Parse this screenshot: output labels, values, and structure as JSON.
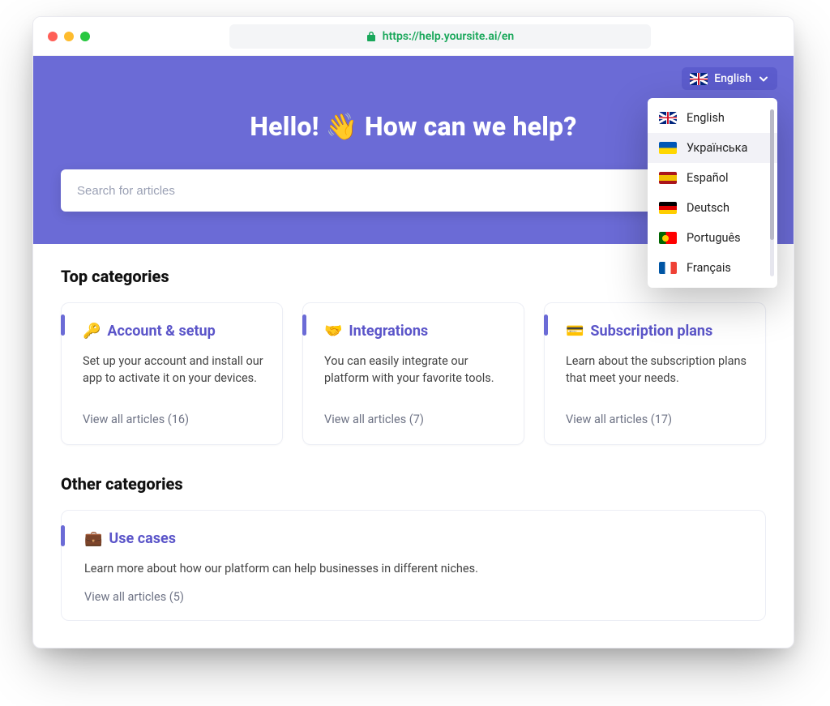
{
  "browser": {
    "url": "https://help.yoursite.ai/en"
  },
  "language_selector": {
    "current": {
      "label": "English",
      "flag": "uk"
    },
    "options": [
      {
        "label": "English",
        "flag": "uk"
      },
      {
        "label": "Українська",
        "flag": "ua"
      },
      {
        "label": "Español",
        "flag": "es"
      },
      {
        "label": "Deutsch",
        "flag": "de"
      },
      {
        "label": "Português",
        "flag": "pt"
      },
      {
        "label": "Français",
        "flag": "fr"
      }
    ],
    "hover_index": 1
  },
  "hero": {
    "title": "Hello! 👋 How can we help?",
    "search_placeholder": "Search for articles"
  },
  "sections": {
    "top": {
      "heading": "Top categories",
      "cards": [
        {
          "emoji": "🔑",
          "title": "Account & setup",
          "desc": "Set up your account and install our app to activate it on your devices.",
          "link": "View all articles (16)"
        },
        {
          "emoji": "🤝",
          "title": "Integrations",
          "desc": "You can easily integrate our platform with your favorite tools.",
          "link": "View all articles (7)"
        },
        {
          "emoji": "💳",
          "title": "Subscription plans",
          "desc": "Learn about the subscription plans that meet your needs.",
          "link": "View all articles (17)"
        }
      ]
    },
    "other": {
      "heading": "Other categories",
      "cards": [
        {
          "emoji": "💼",
          "title": "Use cases",
          "desc": "Learn more about how our platform can help businesses in different niches.",
          "link": "View all articles (5)"
        }
      ]
    }
  },
  "colors": {
    "primary": "#6b6bd6",
    "link": "#5b55c9"
  }
}
